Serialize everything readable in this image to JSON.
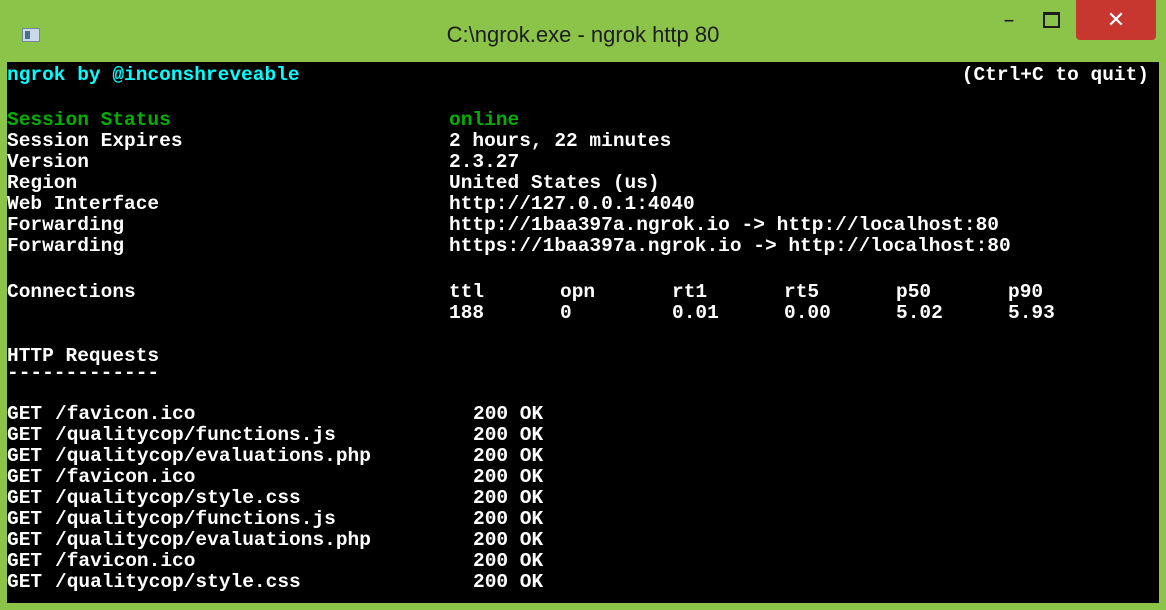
{
  "window": {
    "title": "C:\\ngrok.exe - ngrok  http 80",
    "minimize": "–",
    "close": "✕"
  },
  "colors": {
    "titlebar": "#8cc44a",
    "console_bg": "#000000",
    "header_cyan": "#00ffff",
    "status_green": "#00b000",
    "close_red": "#c7372f"
  },
  "header": {
    "brand": "ngrok by @inconshreveable",
    "quit_hint": "(Ctrl+C to quit)"
  },
  "session": [
    {
      "label": "Session Status",
      "value": "online"
    },
    {
      "label": "Session Expires",
      "value": "2 hours, 22 minutes"
    },
    {
      "label": "Version",
      "value": "2.3.27"
    },
    {
      "label": "Region",
      "value": "United States (us)"
    },
    {
      "label": "Web Interface",
      "value": "http://127.0.0.1:4040"
    },
    {
      "label": "Forwarding",
      "value": "http://1baa397a.ngrok.io -> http://localhost:80"
    },
    {
      "label": "Forwarding",
      "value": "https://1baa397a.ngrok.io -> http://localhost:80"
    }
  ],
  "connections": {
    "label": "Connections",
    "columns": [
      "ttl",
      "opn",
      "rt1",
      "rt5",
      "p50",
      "p90"
    ],
    "values": [
      "188",
      "0",
      "0.01",
      "0.00",
      "5.02",
      "5.93"
    ]
  },
  "http": {
    "title": "HTTP Requests",
    "underline": "-------------",
    "requests": [
      {
        "method": "GET",
        "path": "/favicon.ico",
        "status": "200 OK"
      },
      {
        "method": "GET",
        "path": "/qualitycop/functions.js",
        "status": "200 OK"
      },
      {
        "method": "GET",
        "path": "/qualitycop/evaluations.php",
        "status": "200 OK"
      },
      {
        "method": "GET",
        "path": "/favicon.ico",
        "status": "200 OK"
      },
      {
        "method": "GET",
        "path": "/qualitycop/style.css",
        "status": "200 OK"
      },
      {
        "method": "GET",
        "path": "/qualitycop/functions.js",
        "status": "200 OK"
      },
      {
        "method": "GET",
        "path": "/qualitycop/evaluations.php",
        "status": "200 OK"
      },
      {
        "method": "GET",
        "path": "/favicon.ico",
        "status": "200 OK"
      },
      {
        "method": "GET",
        "path": "/qualitycop/style.css",
        "status": "200 OK"
      }
    ]
  }
}
